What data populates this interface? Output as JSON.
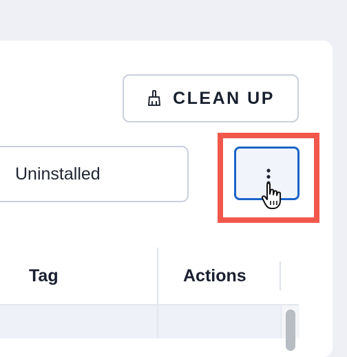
{
  "toolbar": {
    "clean_up_label": "CLEAN UP",
    "clean_up_icon": "broom-icon"
  },
  "filter": {
    "status_value": "Uninstalled"
  },
  "more_menu": {
    "icon": "more-vertical-icon",
    "highlighted": true
  },
  "table": {
    "columns": [
      "Tag",
      "Actions"
    ]
  },
  "colors": {
    "accent": "#1a64c7",
    "highlight": "#f2574c",
    "border": "#c9d0dc"
  }
}
